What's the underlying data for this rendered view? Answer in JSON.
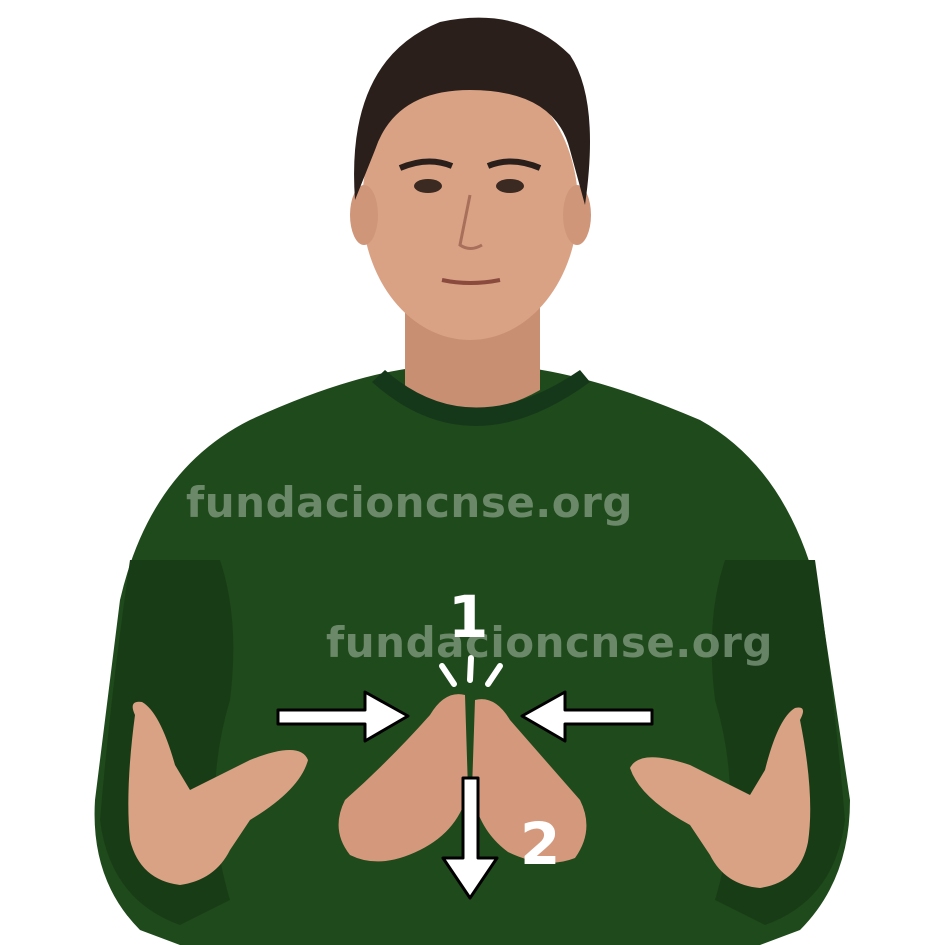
{
  "watermarks": [
    {
      "text": "fundacioncnse.org"
    },
    {
      "text": "fundacioncnse.org"
    }
  ],
  "steps": [
    {
      "number": "1"
    },
    {
      "number": "2"
    }
  ],
  "colors": {
    "background": "#ffffff",
    "shirt": "#1f4a1c",
    "skin": "#d9a285",
    "hair": "#2a1f1a",
    "arrow": "#ffffff",
    "arrow_outline": "#000000"
  },
  "icons": {
    "arrow_left_side": "arrow-right-icon",
    "arrow_right_side": "arrow-left-icon",
    "arrow_down": "arrow-down-icon",
    "contact_marks": "contact-burst-icon"
  }
}
